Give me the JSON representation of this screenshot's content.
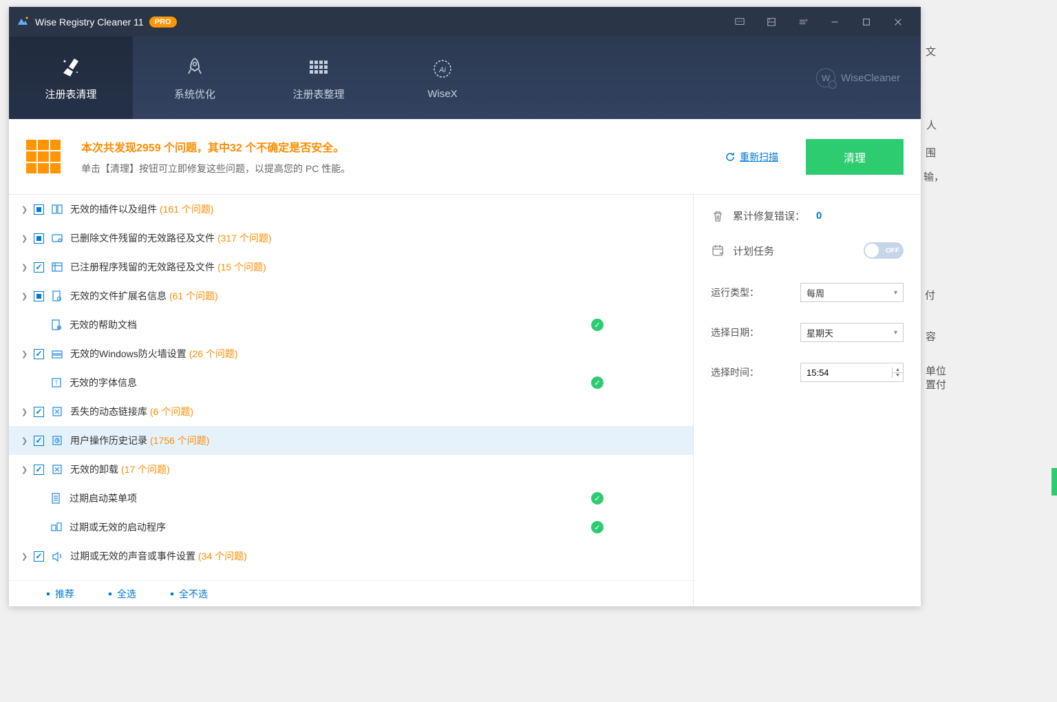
{
  "app": {
    "title": "Wise Registry Cleaner 11",
    "badge": "PRO",
    "brand": "WiseCleaner"
  },
  "nav": {
    "items": [
      {
        "label": "注册表清理"
      },
      {
        "label": "系统优化"
      },
      {
        "label": "注册表整理"
      },
      {
        "label": "WiseX"
      }
    ]
  },
  "summary": {
    "title": "本次共发现2959 个问题，其中32 个不确定是否安全。",
    "sub": "单击【清理】按钮可立即修复这些问题，以提高您的 PC 性能。",
    "rescan": "重新扫描",
    "clean": "清理"
  },
  "categories": [
    {
      "label": "无效的插件以及组件",
      "count": "(161 个问题)",
      "check": "partial",
      "expand": true
    },
    {
      "label": "已删除文件残留的无效路径及文件",
      "count": "(317 个问题)",
      "check": "partial",
      "expand": true
    },
    {
      "label": "已注册程序残留的无效路径及文件",
      "count": "(15 个问题)",
      "check": "checked",
      "expand": true
    },
    {
      "label": "无效的文件扩展名信息",
      "count": "(61 个问题)",
      "check": "partial",
      "expand": true
    },
    {
      "label": "无效的帮助文档",
      "count": "",
      "check": "none",
      "expand": false,
      "ok": true,
      "noindent": true
    },
    {
      "label": "无效的Windows防火墙设置",
      "count": "(26 个问题)",
      "check": "checked",
      "expand": true
    },
    {
      "label": "无效的字体信息",
      "count": "",
      "check": "none",
      "expand": false,
      "ok": true,
      "noindent": true
    },
    {
      "label": "丢失的动态链接库",
      "count": "(6 个问题)",
      "check": "checked",
      "expand": true
    },
    {
      "label": "用户操作历史记录",
      "count": "(1756 个问题)",
      "check": "checked",
      "expand": true,
      "hl": true
    },
    {
      "label": "无效的卸载",
      "count": "(17 个问题)",
      "check": "checked",
      "expand": true
    },
    {
      "label": "过期启动菜单项",
      "count": "",
      "check": "none",
      "expand": false,
      "ok": true,
      "noindent": true
    },
    {
      "label": "过期或无效的启动程序",
      "count": "",
      "check": "none",
      "expand": false,
      "ok": true,
      "noindent": true
    },
    {
      "label": "过期或无效的声音或事件设置",
      "count": "(34 个问题)",
      "check": "checked",
      "expand": true
    }
  ],
  "actions": {
    "recommend": "推荐",
    "all": "全选",
    "none": "全不选"
  },
  "side": {
    "stat_label": "累计修复错误：",
    "stat_val": "0",
    "plan_label": "计划任务",
    "toggle": "OFF",
    "run_type_label": "运行类型：",
    "run_type_val": "每周",
    "date_label": "选择日期：",
    "date_val": "星期天",
    "time_label": "选择时间：",
    "time_val": "15:54"
  }
}
